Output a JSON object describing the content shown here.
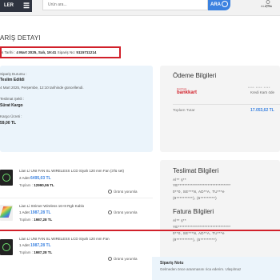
{
  "header": {
    "category_label": "LER",
    "search_placeholder": "Ürün ara...",
    "search_button": "ARA",
    "user_name": "ALİŞAN"
  },
  "page_title": "ARİŞ DETAYI",
  "order_meta": {
    "date_label": "s Tarihi :",
    "date_value": "4 Mart 2025, Salı, 19:41",
    "number_label": "Sipariş No:",
    "number_value": "5115711214"
  },
  "status": {
    "status_label": "Sipariş Durumu :",
    "status_value": "Teslim Edildi",
    "updated_text": "4 Mart 2025, Perşembe, 12:10 tarihinde güncellendi.",
    "shipping_label": "Teslimat Şekli :",
    "shipping_value": "Sürat Kargo",
    "cargo_label": "Kargo Ücreti :",
    "cargo_value": "59,00 TL"
  },
  "payment": {
    "title": "Ödeme Bilgileri",
    "bank_small": "Kredi Kartı",
    "bank_name": "bankkart",
    "card_number": "**** **** ****",
    "card_type": "Kredi Kartı öde",
    "total_label": "Toplam Tutar",
    "total_value": "17.053,62 TL"
  },
  "items": [
    {
      "name": "Lian Li UNI FAN SL WIRELESS LCD Siyah 120 mm Fan (3'lü set)",
      "qty": "2 Adet",
      "price": "6495,03 TL",
      "total_label": "Toplam :",
      "total_value": "12990,06 TL",
      "review": "Ürünü yorumla"
    },
    {
      "name": "Lian Li Strimer Wireless 16+8 Rgb Kablo",
      "qty": "1 Adet",
      "price": "1987,28 TL",
      "total_label": "Toplam :",
      "total_value": "1987,28 TL",
      "review": "Ürünü yorumla"
    },
    {
      "name": "Lian Li UNI FAN SL WIRELESS LCD Siyah 120 mm Fan",
      "qty": "1 Adet",
      "price": "1987,28 TL",
      "total_label": "Toplam :",
      "total_value": "1987,28 TL",
      "review": "Ürünü yorumla"
    }
  ],
  "delivery": {
    "title": "Teslimat Bilgileri",
    "lines": [
      "Al** ş**",
      "YE********************************",
      "0**0, SE***N, AD**A, TU***e",
      "(9**********), (5*********)"
    ]
  },
  "billing": {
    "title": "Fatura Bilgileri",
    "lines": [
      "Al** ş**",
      "YE********************************",
      "0**0, SE***N, AD**A, TU***e",
      "(9**********), (5*********)"
    ]
  },
  "note": {
    "title": "Sipariş Notu",
    "text": "Gelmeden önce aranmasını rica ederim. Ulaşılmaz"
  },
  "colors": {
    "accent": "#3b82e0",
    "highlight": "#d1202a"
  }
}
